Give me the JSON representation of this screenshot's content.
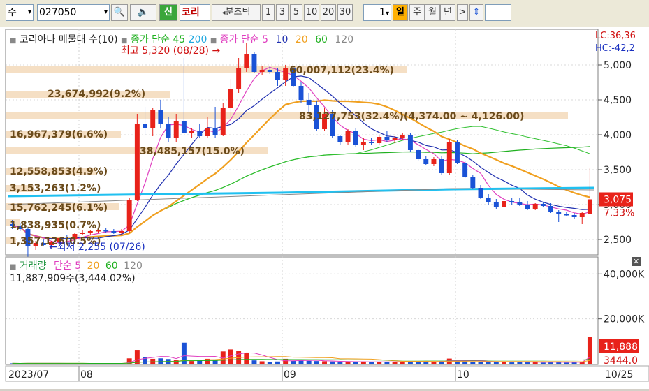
{
  "toolbar": {
    "market_label": "주",
    "code": "027050",
    "name": "코리",
    "shin": "신",
    "range_label": "분초틱",
    "nums": [
      "1",
      "3",
      "5",
      "10",
      "20",
      "30"
    ],
    "period_num": "1",
    "periods": [
      "일",
      "주",
      "월",
      "년"
    ],
    "selected_period": "일"
  },
  "colors": {
    "up": "#e8221a",
    "down": "#1a52d6",
    "ma5": "#e040c0",
    "ma10": "#2030b0",
    "ma20": "#f0a020",
    "ma60": "#20b020",
    "ma45": "#30c030",
    "ma200": "#20c0f0"
  },
  "price_panel": {
    "legend_title": "코리아나 매물대 수(10)",
    "legend_sum1": "종가 단순 45",
    "legend_sum1b": "200",
    "legend_sum2": "종가 단순 5",
    "ma_periods": [
      "10",
      "20",
      "60",
      "120"
    ],
    "high_annot": "최고 5,320 (08/28)",
    "low_annot": "최저 2,255 (07/26)",
    "lc": "LC:36,36",
    "hc": "HC:-42,2",
    "price_ticks": [
      "5,000",
      "4,500",
      "4,000",
      "3,500",
      "3,000",
      "2,500"
    ],
    "current_price": "3,075",
    "current_pct": "7.33%",
    "volume_profile": [
      "60,007,112(23.4%)",
      "23,674,992(9.2%)",
      "83,127,753(32.4%)(4,374.00 ~ 4,126.00)",
      "16,967,379(6.6%)",
      "38,485,157(15.0%)",
      "12,558,853(4.9%)",
      "3,153,263(1.2%)",
      "15,762,245(6.1%)",
      "1,838,935(0.7%)",
      "1,357,126(0.5%)"
    ]
  },
  "volume_panel": {
    "legend_title": "거래량",
    "legend_ma": "단순 5",
    "ma_periods": [
      "20",
      "60",
      "120"
    ],
    "total": "11,887,909주(3,444.02%)",
    "ticks": [
      "40,000K",
      "20,000K"
    ],
    "current_vol": "11,888",
    "current_vol_pct": "3444.0"
  },
  "x_axis": {
    "labels": [
      "2023/07",
      "08",
      "09",
      "10",
      "10/25"
    ]
  },
  "chart_data": {
    "type": "candlestick",
    "candles": [
      {
        "o": 2720,
        "h": 2780,
        "l": 2650,
        "c": 2700,
        "v": 180
      },
      {
        "o": 2700,
        "h": 2740,
        "l": 2620,
        "c": 2650,
        "v": 150
      },
      {
        "o": 2650,
        "h": 2680,
        "l": 2255,
        "c": 2400,
        "v": 260
      },
      {
        "o": 2400,
        "h": 2480,
        "l": 2350,
        "c": 2450,
        "v": 200
      },
      {
        "o": 2450,
        "h": 2500,
        "l": 2400,
        "c": 2420,
        "v": 160
      },
      {
        "o": 2420,
        "h": 2480,
        "l": 2380,
        "c": 2460,
        "v": 140
      },
      {
        "o": 2460,
        "h": 2540,
        "l": 2430,
        "c": 2520,
        "v": 170
      },
      {
        "o": 2520,
        "h": 2560,
        "l": 2480,
        "c": 2500,
        "v": 150
      },
      {
        "o": 2500,
        "h": 2600,
        "l": 2480,
        "c": 2580,
        "v": 180
      },
      {
        "o": 2580,
        "h": 2640,
        "l": 2560,
        "c": 2600,
        "v": 160
      },
      {
        "o": 2600,
        "h": 2640,
        "l": 2570,
        "c": 2620,
        "v": 120
      },
      {
        "o": 2620,
        "h": 2660,
        "l": 2600,
        "c": 2630,
        "v": 110
      },
      {
        "o": 2630,
        "h": 2660,
        "l": 2600,
        "c": 2620,
        "v": 100
      },
      {
        "o": 2620,
        "h": 2650,
        "l": 2580,
        "c": 2600,
        "v": 90
      },
      {
        "o": 2600,
        "h": 2650,
        "l": 2570,
        "c": 2620,
        "v": 120
      },
      {
        "o": 2620,
        "h": 3100,
        "l": 2600,
        "c": 3060,
        "v": 2400
      },
      {
        "o": 3060,
        "h": 4300,
        "l": 3050,
        "c": 4150,
        "v": 6200
      },
      {
        "o": 4150,
        "h": 4400,
        "l": 4000,
        "c": 4100,
        "v": 3000
      },
      {
        "o": 4100,
        "h": 4380,
        "l": 3980,
        "c": 4350,
        "v": 2200
      },
      {
        "o": 4350,
        "h": 4500,
        "l": 4100,
        "c": 4150,
        "v": 2400
      },
      {
        "o": 4150,
        "h": 4250,
        "l": 3900,
        "c": 3950,
        "v": 2100
      },
      {
        "o": 3950,
        "h": 4300,
        "l": 3900,
        "c": 4200,
        "v": 1800
      },
      {
        "o": 4200,
        "h": 5100,
        "l": 4150,
        "c": 4020,
        "v": 9400
      },
      {
        "o": 4020,
        "h": 4100,
        "l": 3950,
        "c": 4050,
        "v": 1200
      },
      {
        "o": 4050,
        "h": 4150,
        "l": 3950,
        "c": 3980,
        "v": 1600
      },
      {
        "o": 3980,
        "h": 4250,
        "l": 3950,
        "c": 4100,
        "v": 2200
      },
      {
        "o": 4100,
        "h": 4400,
        "l": 3950,
        "c": 4000,
        "v": 1900
      },
      {
        "o": 4000,
        "h": 4450,
        "l": 3980,
        "c": 4380,
        "v": 5500
      },
      {
        "o": 4380,
        "h": 4800,
        "l": 4250,
        "c": 4650,
        "v": 6400
      },
      {
        "o": 4650,
        "h": 5100,
        "l": 4600,
        "c": 4950,
        "v": 5800
      },
      {
        "o": 4950,
        "h": 5320,
        "l": 4900,
        "c": 5150,
        "v": 4700
      },
      {
        "o": 5150,
        "h": 5180,
        "l": 4880,
        "c": 4900,
        "v": 1500
      },
      {
        "o": 4900,
        "h": 4980,
        "l": 4850,
        "c": 4930,
        "v": 1100
      },
      {
        "o": 4930,
        "h": 4980,
        "l": 4870,
        "c": 4900,
        "v": 900
      },
      {
        "o": 4900,
        "h": 4950,
        "l": 4700,
        "c": 4780,
        "v": 1000
      },
      {
        "o": 4780,
        "h": 5000,
        "l": 4700,
        "c": 4950,
        "v": 2200
      },
      {
        "o": 4950,
        "h": 4990,
        "l": 4680,
        "c": 4700,
        "v": 1400
      },
      {
        "o": 4700,
        "h": 4750,
        "l": 4450,
        "c": 4500,
        "v": 1600
      },
      {
        "o": 4500,
        "h": 4600,
        "l": 4300,
        "c": 4420,
        "v": 1300
      },
      {
        "o": 4420,
        "h": 4480,
        "l": 4050,
        "c": 4080,
        "v": 1200
      },
      {
        "o": 4080,
        "h": 4380,
        "l": 4050,
        "c": 4300,
        "v": 1100
      },
      {
        "o": 4300,
        "h": 4350,
        "l": 3950,
        "c": 3980,
        "v": 1000
      },
      {
        "o": 3980,
        "h": 4000,
        "l": 3850,
        "c": 3900,
        "v": 800
      },
      {
        "o": 3900,
        "h": 4080,
        "l": 3850,
        "c": 4050,
        "v": 800
      },
      {
        "o": 4050,
        "h": 4100,
        "l": 3820,
        "c": 3850,
        "v": 900
      },
      {
        "o": 3850,
        "h": 3950,
        "l": 3780,
        "c": 3900,
        "v": 1000
      },
      {
        "o": 3900,
        "h": 3950,
        "l": 3850,
        "c": 3880,
        "v": 800
      },
      {
        "o": 3880,
        "h": 4000,
        "l": 3860,
        "c": 3970,
        "v": 900
      },
      {
        "o": 3970,
        "h": 4050,
        "l": 3900,
        "c": 3920,
        "v": 800
      },
      {
        "o": 3920,
        "h": 3980,
        "l": 3880,
        "c": 3950,
        "v": 850
      },
      {
        "o": 3950,
        "h": 4030,
        "l": 3920,
        "c": 3990,
        "v": 900
      },
      {
        "o": 3990,
        "h": 4030,
        "l": 3750,
        "c": 3780,
        "v": 1000
      },
      {
        "o": 3780,
        "h": 3800,
        "l": 3630,
        "c": 3650,
        "v": 1100
      },
      {
        "o": 3650,
        "h": 3700,
        "l": 3560,
        "c": 3580,
        "v": 900
      },
      {
        "o": 3580,
        "h": 3680,
        "l": 3550,
        "c": 3650,
        "v": 800
      },
      {
        "o": 3650,
        "h": 3700,
        "l": 3420,
        "c": 3450,
        "v": 1200
      },
      {
        "o": 3450,
        "h": 3940,
        "l": 3430,
        "c": 3900,
        "v": 2300
      },
      {
        "o": 3900,
        "h": 3920,
        "l": 3580,
        "c": 3600,
        "v": 1400
      },
      {
        "o": 3600,
        "h": 3620,
        "l": 3380,
        "c": 3400,
        "v": 1200
      },
      {
        "o": 3400,
        "h": 3420,
        "l": 3220,
        "c": 3240,
        "v": 1000
      },
      {
        "o": 3240,
        "h": 3280,
        "l": 3080,
        "c": 3100,
        "v": 900
      },
      {
        "o": 3100,
        "h": 3150,
        "l": 3000,
        "c": 3030,
        "v": 900
      },
      {
        "o": 3030,
        "h": 3080,
        "l": 2930,
        "c": 2960,
        "v": 800
      },
      {
        "o": 2960,
        "h": 3100,
        "l": 2940,
        "c": 3050,
        "v": 900
      },
      {
        "o": 3050,
        "h": 3090,
        "l": 3000,
        "c": 3040,
        "v": 600
      },
      {
        "o": 3040,
        "h": 3100,
        "l": 2980,
        "c": 3000,
        "v": 700
      },
      {
        "o": 3000,
        "h": 3050,
        "l": 2920,
        "c": 2940,
        "v": 800
      },
      {
        "o": 2940,
        "h": 3020,
        "l": 2920,
        "c": 3010,
        "v": 700
      },
      {
        "o": 3010,
        "h": 3040,
        "l": 2960,
        "c": 2980,
        "v": 500
      },
      {
        "o": 2980,
        "h": 3020,
        "l": 2880,
        "c": 2900,
        "v": 700
      },
      {
        "o": 2900,
        "h": 2920,
        "l": 2750,
        "c": 2860,
        "v": 800
      },
      {
        "o": 2860,
        "h": 2900,
        "l": 2830,
        "c": 2850,
        "v": 500
      },
      {
        "o": 2850,
        "h": 2880,
        "l": 2790,
        "c": 2820,
        "v": 700
      },
      {
        "o": 2820,
        "h": 2900,
        "l": 2720,
        "c": 2880,
        "v": 900
      },
      {
        "o": 2865,
        "h": 3520,
        "l": 2860,
        "c": 3075,
        "v": 11888
      }
    ],
    "ylim": [
      2300,
      5450
    ],
    "vol_max": 46000
  }
}
